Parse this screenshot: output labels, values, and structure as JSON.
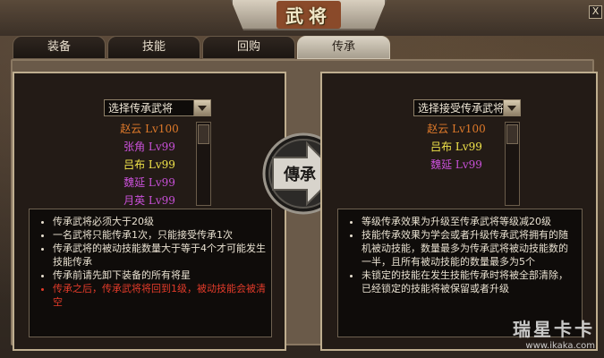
{
  "window": {
    "title": "武将",
    "close_label": "X"
  },
  "tabs": [
    {
      "label": "装备"
    },
    {
      "label": "技能"
    },
    {
      "label": "回购"
    },
    {
      "label": "传承",
      "active": true
    }
  ],
  "left_panel": {
    "select_label": "选择传承武将",
    "generals": [
      {
        "name": "赵云",
        "level": "Lv100",
        "color": "#e07a2a"
      },
      {
        "name": "张角",
        "level": "Lv99",
        "color": "#c850d8"
      },
      {
        "name": "吕布",
        "level": "Lv99",
        "color": "#f0e34a"
      },
      {
        "name": "魏延",
        "level": "Lv99",
        "color": "#c850d8"
      },
      {
        "name": "月英",
        "level": "Lv99",
        "color": "#c850d8"
      }
    ],
    "rules": [
      {
        "text": "传承武将必须大于20级",
        "warn": false
      },
      {
        "text": "一名武将只能传承1次，只能接受传承1次",
        "warn": false
      },
      {
        "text": "传承武将的被动技能数量大于等于4个才可能发生技能传承",
        "warn": false
      },
      {
        "text": "传承前请先卸下装备的所有将星",
        "warn": false
      },
      {
        "text": "传承之后，传承武将将回到1级，被动技能会被清空",
        "warn": true
      }
    ]
  },
  "center": {
    "button_label": "傳承",
    "button_icon": "arrow-right-icon"
  },
  "right_panel": {
    "select_label": "选择接受传承武将",
    "generals": [
      {
        "name": "赵云",
        "level": "Lv100",
        "color": "#e07a2a"
      },
      {
        "name": "吕布",
        "level": "Lv99",
        "color": "#f0e34a"
      },
      {
        "name": "魏延",
        "level": "Lv99",
        "color": "#c850d8"
      }
    ],
    "rules": [
      {
        "text": "等级传承效果为升级至传承武将等级减20级",
        "warn": false
      },
      {
        "text": "技能传承效果为学会或者升级传承武将拥有的随机被动技能，数量最多为传承武将被动技能数的一半，且所有被动技能的数量最多为5个",
        "warn": false
      },
      {
        "text": "未锁定的技能在发生技能传承时将被全部清除，已经锁定的技能将被保留或者升级",
        "warn": false
      }
    ]
  },
  "watermark": {
    "logo": "瑞星卡卡",
    "url": "www.ikaka.com"
  },
  "colors": {
    "accent_orange": "#e07a2a",
    "purple": "#c850d8",
    "yellow": "#f0e34a",
    "warn_red": "#e33b2a"
  }
}
